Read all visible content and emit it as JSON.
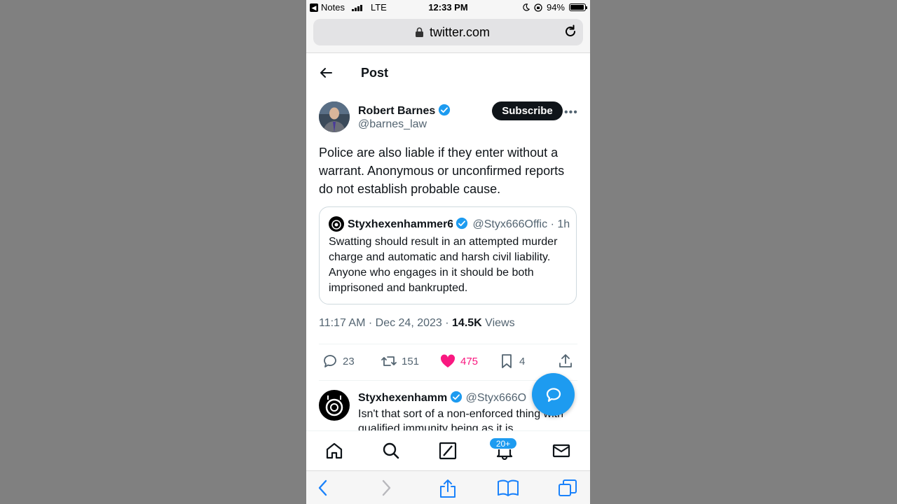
{
  "status_bar": {
    "back_app": "Notes",
    "carrier": "LTE",
    "time": "12:33 PM",
    "battery": "94%",
    "battery_level": 0.94
  },
  "browser": {
    "url": "twitter.com"
  },
  "header": {
    "title": "Post"
  },
  "tweet": {
    "author_name": "Robert Barnes",
    "author_handle": "@barnes_law",
    "subscribe_label": "Subscribe",
    "more_label": "•••",
    "text": "Police are also liable if they enter without a warrant. Anonymous or unconfirmed reports do not establish probable cause.",
    "quote": {
      "name": "Styxhexenhammer6",
      "handle": "@Styx666Offic",
      "time": "· 1h",
      "text": "Swatting should result in an attempted murder charge and automatic and harsh civil liability. Anyone who engages in it should be both imprisoned and bankrupted."
    },
    "timestamp": "11:17 AM · Dec 24, 2023 · ",
    "views_count": "14.5K",
    "views_label": " Views",
    "actions": {
      "replies": "23",
      "retweets": "151",
      "likes": "475",
      "bookmarks": "4"
    }
  },
  "reply": {
    "name": "Styxhexenhamm",
    "handle": "@Styx666O",
    "text": "Isn't that sort of a non-enforced thing with qualified immunity being as it is"
  },
  "bottom_nav": {
    "notifications_badge": "20+"
  },
  "colors": {
    "accent": "#1d9bf0",
    "like": "#f91880",
    "text": "#0f1419",
    "secondary": "#536471"
  }
}
